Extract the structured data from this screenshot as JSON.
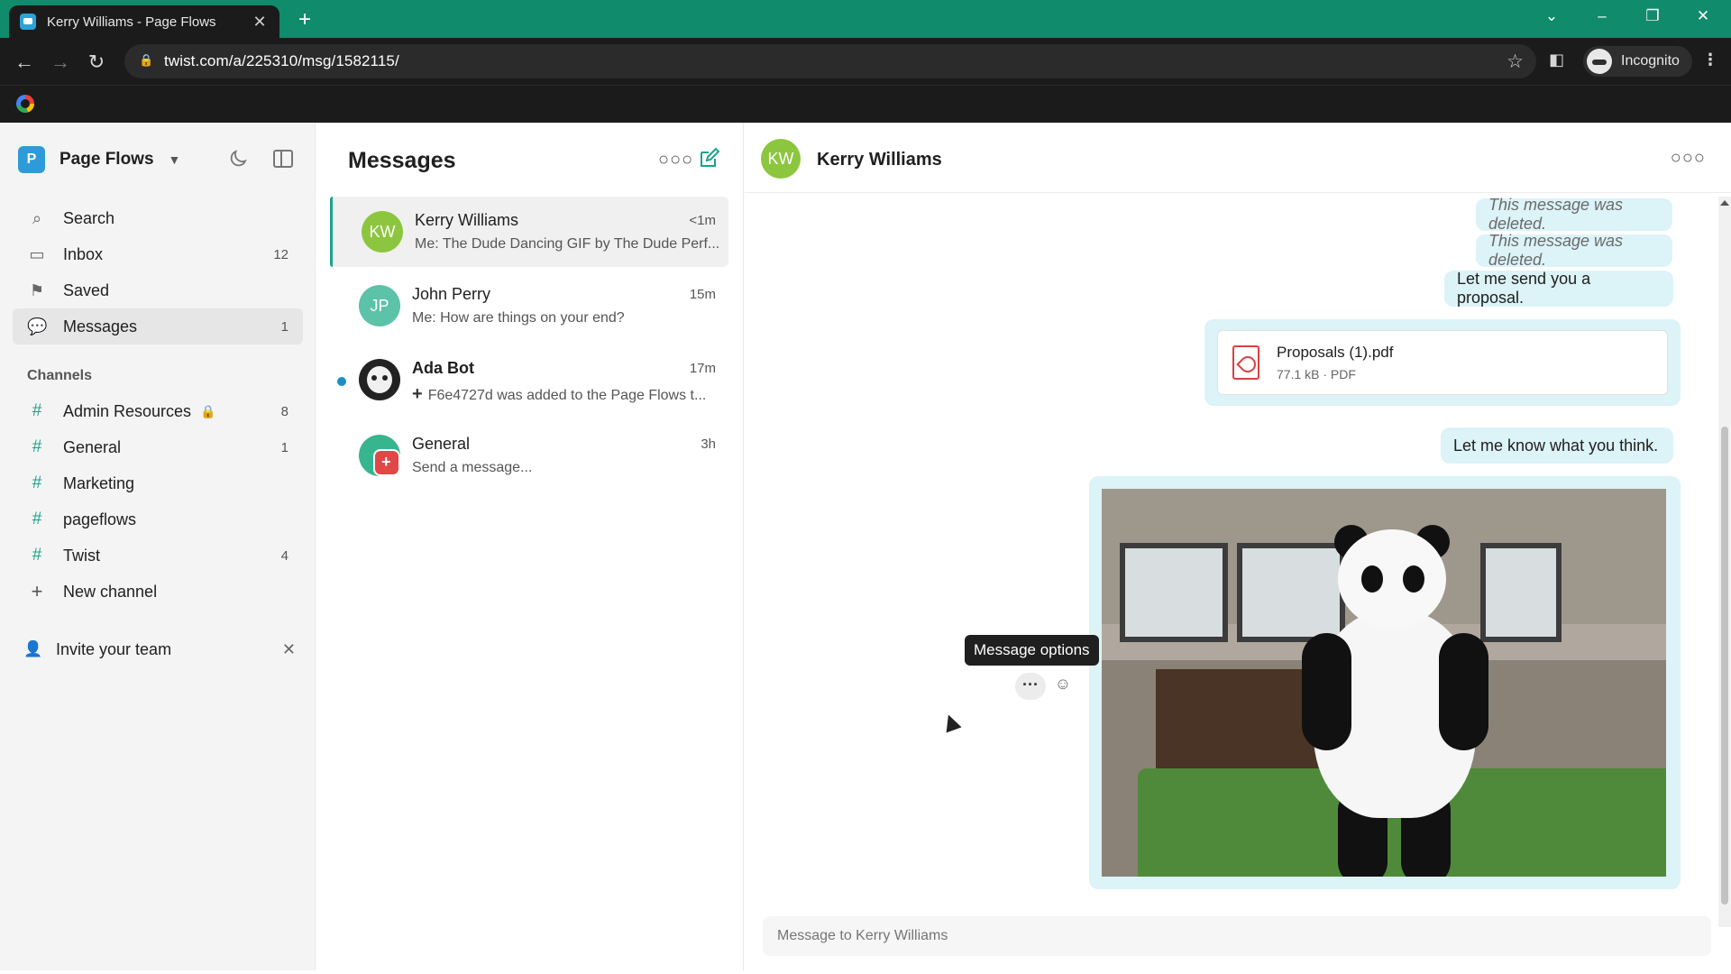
{
  "browser": {
    "tab_title": "Kerry Williams - Page Flows",
    "url": "twist.com/a/225310/msg/1582115/",
    "profile_label": "Incognito"
  },
  "sidebar": {
    "workspace_initial": "P",
    "workspace_name": "Page Flows",
    "nav": [
      {
        "label": "Search",
        "icon": "search-icon",
        "count": ""
      },
      {
        "label": "Inbox",
        "icon": "inbox-icon",
        "count": "12"
      },
      {
        "label": "Saved",
        "icon": "bookmark-icon",
        "count": ""
      },
      {
        "label": "Messages",
        "icon": "chat-icon",
        "count": "1"
      }
    ],
    "channels_title": "Channels",
    "channels": [
      {
        "label": "Admin Resources",
        "count": "8",
        "locked": true
      },
      {
        "label": "General",
        "count": "1"
      },
      {
        "label": "Marketing",
        "count": ""
      },
      {
        "label": "pageflows",
        "count": ""
      },
      {
        "label": "Twist",
        "count": "4"
      }
    ],
    "new_channel_label": "New channel",
    "invite_label": "Invite your team"
  },
  "messages": {
    "title": "Messages",
    "conversations": [
      {
        "initials": "KW",
        "name": "Kerry Williams",
        "time": "<1m",
        "preview": "Me: The Dude Dancing GIF by The Dude Perf...",
        "color": "#8cc63f"
      },
      {
        "initials": "JP",
        "name": "John Perry",
        "time": "15m",
        "preview": "Me: How are things on your end?",
        "color": "#5cc2a8"
      },
      {
        "initials": "",
        "name": "Ada Bot",
        "time": "17m",
        "preview": "F6e4727d was added to the Page Flows t...",
        "unread": true
      },
      {
        "initials": "",
        "name": "General",
        "time": "3h",
        "preview": "Send a message..."
      }
    ]
  },
  "chat": {
    "initials": "KW",
    "name": "Kerry Williams",
    "deleted_text": "This message was deleted.",
    "msg_proposal": "Let me send you a proposal.",
    "file_name": "Proposals (1).pdf",
    "file_meta": "77.1 kB · PDF",
    "msg_think": "Let me know what you think.",
    "tooltip": "Message options",
    "composer_placeholder": "Message to Kerry Williams"
  },
  "colors": {
    "accent": "#1aa38a",
    "bubble": "#dcf3f8",
    "tabbar": "#108b6b"
  }
}
